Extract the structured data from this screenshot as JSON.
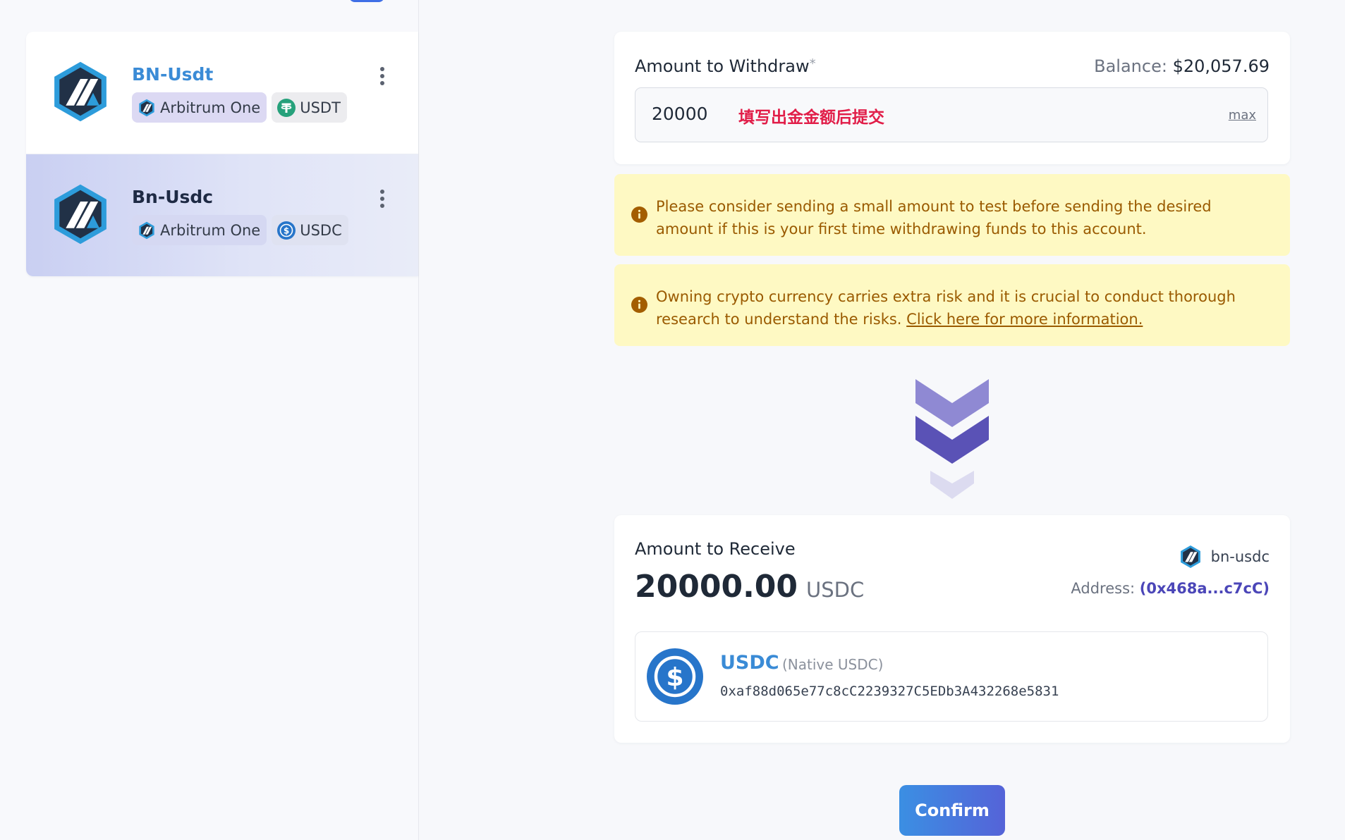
{
  "accounts": [
    {
      "name": "BN-Usdt",
      "network": "Arbitrum One",
      "token": "USDT",
      "selected": false,
      "name_color": "#3a8bd6"
    },
    {
      "name": "Bn-Usdc",
      "network": "Arbitrum One",
      "token": "USDC",
      "selected": true,
      "name_color": "#1e2a44"
    }
  ],
  "withdraw": {
    "label": "Amount to Withdraw",
    "required_mark": "*",
    "balance_label": "Balance:",
    "balance_value": "$20,057.69",
    "amount_value": "20000",
    "hint": "填写出金金额后提交",
    "max_label": "max"
  },
  "notices": [
    {
      "text": "Please consider sending a small amount to test before sending the desired amount if this is your first time withdrawing funds to this account."
    },
    {
      "text": "Owning crypto currency carries extra risk and it is crucial to conduct thorough research to understand the risks.",
      "link": "Click here for more information."
    }
  ],
  "receive": {
    "label": "Amount to Receive",
    "amount": "20000.00",
    "unit": "USDC",
    "destination_name": "bn-usdc",
    "address_label": "Address:",
    "address_value": "(0x468a...c7cC)",
    "token_symbol": "USDC",
    "token_subtitle": "(Native USDC)",
    "token_contract": "0xaf88d065e77c8cC2239327C5EDb3A432268e5831"
  },
  "confirm_label": "Confirm",
  "icons": {
    "arbitrum": "arbitrum-logo-icon",
    "tether": "tether-icon",
    "usdc": "usdc-icon",
    "info": "info-icon",
    "kebab": "kebab-menu-icon",
    "chevrons": "chevron-down-icon"
  },
  "colors": {
    "accent": "#3a8bd6",
    "warning_bg": "#fef9c3",
    "warning_text": "#9a5a00",
    "hint": "#e11d48",
    "address": "#4b46b8"
  }
}
